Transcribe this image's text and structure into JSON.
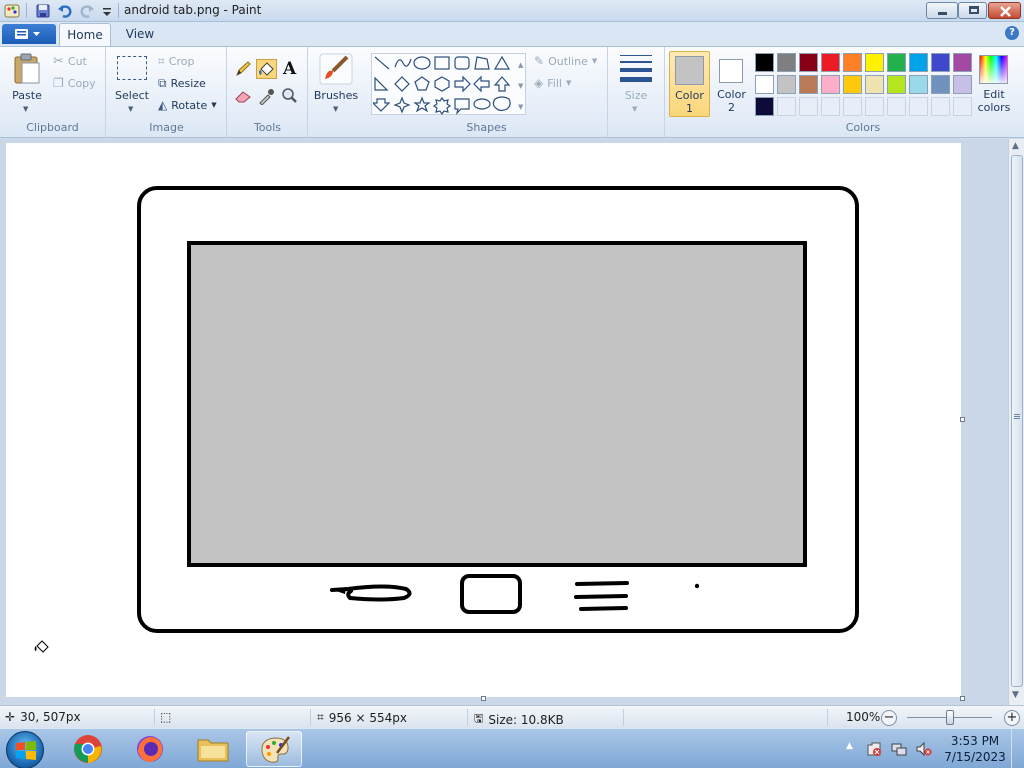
{
  "window": {
    "title": "android tab.png - Paint"
  },
  "tabs": [
    {
      "label": "Home",
      "active": true
    },
    {
      "label": "View",
      "active": false
    }
  ],
  "ribbon": {
    "clipboard": {
      "group_label": "Clipboard",
      "paste": "Paste",
      "cut": "Cut",
      "copy": "Copy"
    },
    "image": {
      "group_label": "Image",
      "select": "Select",
      "crop": "Crop",
      "resize": "Resize",
      "rotate": "Rotate"
    },
    "tools": {
      "group_label": "Tools"
    },
    "brushes": {
      "label": "Brushes"
    },
    "shapes": {
      "group_label": "Shapes",
      "outline": "Outline",
      "fill": "Fill"
    },
    "size": {
      "label": "Size"
    },
    "color1": {
      "label": "Color",
      "number": "1",
      "color": "#c3c3c3"
    },
    "color2": {
      "label": "Color",
      "number": "2",
      "color": "#ffffff"
    },
    "colors": {
      "group_label": "Colors",
      "edit_label": "Edit",
      "edit_label2": "colors",
      "row1": [
        "#000000",
        "#7f7f7f",
        "#880015",
        "#ed1c24",
        "#ff7f27",
        "#fff200",
        "#22b14c",
        "#00a2e8",
        "#3f48cc",
        "#a349a4"
      ],
      "row2": [
        "#ffffff",
        "#c3c3c3",
        "#b97a57",
        "#ffaec9",
        "#ffc90e",
        "#efe4b0",
        "#b5e61d",
        "#99d9ea",
        "#7092be",
        "#c8bfe7"
      ],
      "row3": [
        "#0e0a3a"
      ]
    }
  },
  "status": {
    "cursor_pos": "30, 507px",
    "image_dims": "956 × 554px",
    "file_size": "Size: 10.8KB",
    "zoom": "100%",
    "zoom_fraction": 0.5
  },
  "taskbar": {
    "time": "3:53 PM",
    "date": "7/15/2023"
  }
}
